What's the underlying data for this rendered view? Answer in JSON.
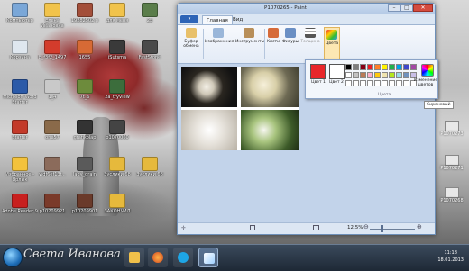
{
  "window": {
    "title": "P1070265 - Paint",
    "minimize": "–",
    "maximize": "□",
    "close": "✕"
  },
  "tabs": {
    "menu": "▾",
    "home": "Главная",
    "view": "Вид"
  },
  "ribbon": {
    "clipboard": "Буфер обмена",
    "images": "Изображения",
    "tools": "Инструменты",
    "brushes": "Кисти",
    "shapes": "Фигуры",
    "thickness": "Толщина",
    "colors": "Цвета"
  },
  "color_panel": {
    "color1": "Цвет 1",
    "color2": "Цвет 2",
    "edit_colors": "Изменение цветов",
    "group": "Цвета",
    "tooltip": "Сиреневый",
    "color1_value": "#e8262a",
    "color2_value": "#ffffff",
    "palette_row1": [
      "#000000",
      "#7f7f7f",
      "#880015",
      "#ed1c24",
      "#ff7f27",
      "#fff200",
      "#22b14c",
      "#00a2e8",
      "#3f48cc",
      "#a349a4"
    ],
    "palette_row2": [
      "#ffffff",
      "#c3c3c3",
      "#b97a57",
      "#ffaec9",
      "#ffc90e",
      "#efe4b0",
      "#b5e61d",
      "#99d9ea",
      "#7092be",
      "#c8bfe7"
    ],
    "palette_row3": [
      "#ffffff",
      "#ffffff",
      "#ffffff",
      "#ffffff",
      "#ffffff",
      "#ffffff",
      "#ffffff",
      "#ffffff",
      "#ffffff",
      "#ffffff"
    ]
  },
  "status": {
    "zoom": "12,5%",
    "minus": "⊖",
    "plus": "⊕"
  },
  "desktop_icons": [
    {
      "label": "Компьютер"
    },
    {
      "label": "Елена Ивановна"
    },
    {
      "label": "19282502 р"
    },
    {
      "label": "для меня"
    },
    {
      "label": "25"
    },
    {
      "label": "Корзина"
    },
    {
      "label": "8_f3f2_1497"
    },
    {
      "label": "1655"
    },
    {
      "label": "iSutsma"
    },
    {
      "label": "FastStone"
    },
    {
      "label": "Microsoft Word Starter"
    },
    {
      "label": "1_4"
    },
    {
      "label": "7t_6"
    },
    {
      "label": "2a_tryView"
    },
    {
      "label": "ЗАКОНЧИЛ"
    },
    {
      "label": "Starter"
    },
    {
      "label": "one57"
    },
    {
      "label": "grafikolap"
    },
    {
      "label": "p1070060"
    },
    {
      "label": "Избранное - Ярлык"
    },
    {
      "label": "wdf6ef13f..."
    },
    {
      "label": "lady_grajn"
    },
    {
      "label": "Зуслики 68"
    },
    {
      "label": "Adobe Reader 9"
    },
    {
      "label": "p10209921"
    },
    {
      "label": "p10209901"
    },
    {
      "label": "Зуслики 68"
    }
  ],
  "right_icons": [
    {
      "label": "P1070273"
    },
    {
      "label": "P1070271"
    },
    {
      "label": "P1070268"
    }
  ],
  "taskbar": {
    "watermark": "Света Иванова",
    "time": "11:18",
    "date": "18.01.2013"
  }
}
